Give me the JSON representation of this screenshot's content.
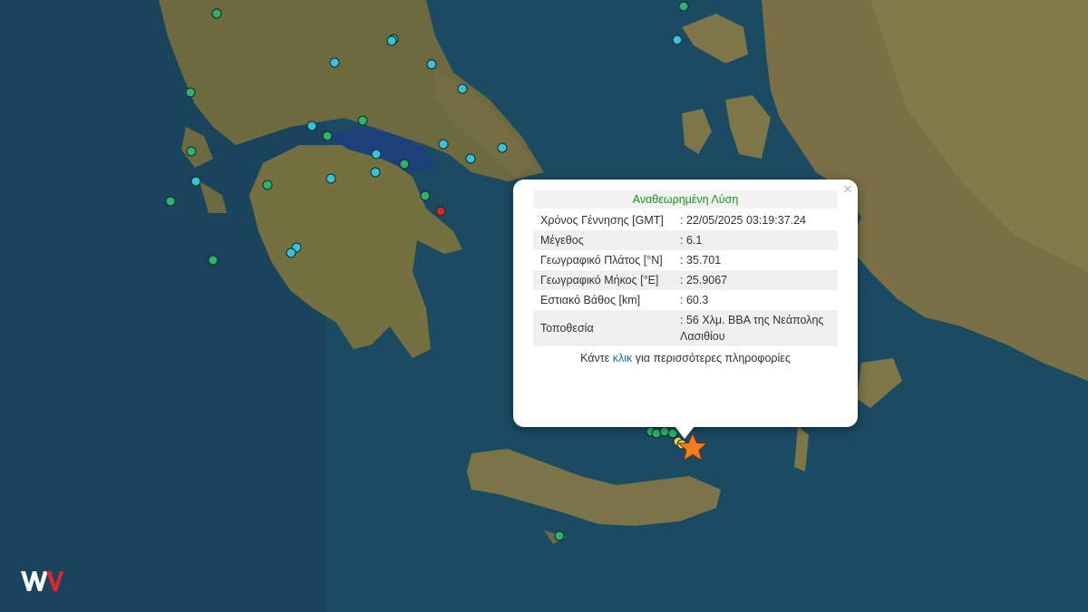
{
  "popup": {
    "title": "Αναθεωρημένη Λύση",
    "close_icon": "×",
    "rows": [
      {
        "key": "Χρόνος Γέννησης [GMT]",
        "value": ": 22/05/2025 03:19:37.24"
      },
      {
        "key": "Μέγεθος",
        "value": ": 6.1"
      },
      {
        "key": "Γεωγραφικό Πλάτος [°N]",
        "value": ": 35.701"
      },
      {
        "key": "Γεωγραφικό Μήκος [°E]",
        "value": ": 25.9067"
      },
      {
        "key": "Εστιακό Βάθος [km]",
        "value": ": 60.3"
      },
      {
        "key": "Τοποθεσία",
        "value": ": 56 Χλμ. ΒΒΑ της Νεάπολης Λασιθίου"
      }
    ],
    "more_prefix": "Κάντε ",
    "more_link": "κλικ",
    "more_suffix": " για περισσότερες πληροφορίες"
  },
  "colors": {
    "sea": "#1b4a63",
    "land": "#7d7446",
    "marker_green": "#2fb36a",
    "marker_cyan": "#39c1d6",
    "marker_red": "#d7261e",
    "marker_yellow": "#e8d64a",
    "epicenter_star": "#f47b20"
  },
  "logo": {
    "icon": "wv-logo"
  }
}
